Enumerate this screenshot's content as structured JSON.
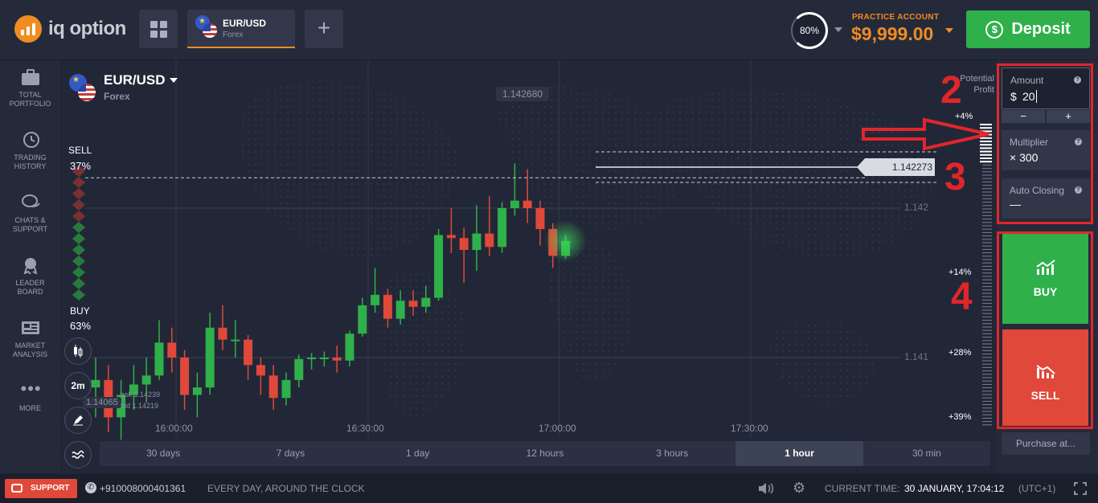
{
  "header": {
    "logo_text": "iq option",
    "asset_tab": {
      "name": "EUR/USD",
      "type": "Forex"
    },
    "profit_percent": "80%",
    "account_label": "PRACTICE ACCOUNT",
    "balance": "$9,999.00",
    "deposit_label": "Deposit"
  },
  "sidebar": {
    "items": [
      {
        "label": "TOTAL PORTFOLIO",
        "icon": "briefcase-icon"
      },
      {
        "label": "TRADING HISTORY",
        "icon": "history-icon"
      },
      {
        "label": "CHATS & SUPPORT",
        "icon": "chat-icon"
      },
      {
        "label": "LEADER BOARD",
        "icon": "medal-icon"
      },
      {
        "label": "MARKET ANALYSIS",
        "icon": "newspaper-icon"
      },
      {
        "label": "MORE",
        "icon": "dots-icon"
      }
    ]
  },
  "chart": {
    "asset": "EUR/USD",
    "asset_type": "Forex",
    "potential_profit_label": "Potential Profit",
    "sell_label": "SELL",
    "sell_pct": "37%",
    "buy_label": "BUY",
    "buy_pct": "63%",
    "price_tag_top": "1.142680",
    "current_price": "1.142273",
    "price_labels": [
      "1.142",
      "1.141"
    ],
    "low_price_tag": "1.14065",
    "ask": "ask 1.14239",
    "bid": "bid 1.14219",
    "time_labels": [
      "16:00:00",
      "16:30:00",
      "17:00:00",
      "17:30:00"
    ],
    "profit_scale": [
      "+4%",
      "+14%",
      "+28%",
      "+39%"
    ],
    "timeframe_button": "2m"
  },
  "timeframes": [
    "30 days",
    "7 days",
    "1 day",
    "12 hours",
    "3 hours",
    "1 hour",
    "30 min"
  ],
  "active_timeframe": "1 hour",
  "trade_panel": {
    "amount_label": "Amount",
    "amount_currency": "$",
    "amount_value": "20",
    "minus": "−",
    "plus": "+",
    "multiplier_label": "Multiplier",
    "multiplier_value": "× 300",
    "auto_closing_label": "Auto Closing",
    "auto_closing_value": "—",
    "buy_label": "BUY",
    "sell_label": "SELL",
    "purchase_at": "Purchase at..."
  },
  "annotations": [
    "2",
    "3",
    "4"
  ],
  "footer": {
    "support_label": "SUPPORT",
    "phone": "+910008000401361",
    "hours": "EVERY DAY, AROUND THE CLOCK",
    "current_time_label": "CURRENT TIME:",
    "current_time_value": "30 JANUARY, 17:04:12",
    "timezone": "(UTC+1)"
  },
  "colors": {
    "accent": "#f08c22",
    "buy": "#2fb04a",
    "sell": "#e0483a",
    "annotation": "#e1262b"
  },
  "candles": [
    {
      "o": 1.1408,
      "c": 1.14085,
      "h": 1.141,
      "l": 1.1406
    },
    {
      "o": 1.14085,
      "c": 1.1406,
      "h": 1.14095,
      "l": 1.1405
    },
    {
      "o": 1.1406,
      "c": 1.14075,
      "h": 1.14085,
      "l": 1.14045
    },
    {
      "o": 1.14075,
      "c": 1.14082,
      "h": 1.14095,
      "l": 1.14065
    },
    {
      "o": 1.14082,
      "c": 1.14088,
      "h": 1.141,
      "l": 1.1407
    },
    {
      "o": 1.14088,
      "c": 1.1411,
      "h": 1.14125,
      "l": 1.14085
    },
    {
      "o": 1.1411,
      "c": 1.141,
      "h": 1.1412,
      "l": 1.1409
    },
    {
      "o": 1.141,
      "c": 1.14075,
      "h": 1.14105,
      "l": 1.14065
    },
    {
      "o": 1.14075,
      "c": 1.1408,
      "h": 1.1409,
      "l": 1.1406
    },
    {
      "o": 1.1408,
      "c": 1.1412,
      "h": 1.1413,
      "l": 1.14075
    },
    {
      "o": 1.1412,
      "c": 1.14112,
      "h": 1.14135,
      "l": 1.14105
    },
    {
      "o": 1.14112,
      "c": 1.14112,
      "h": 1.14125,
      "l": 1.141
    },
    {
      "o": 1.14112,
      "c": 1.14095,
      "h": 1.14115,
      "l": 1.14085
    },
    {
      "o": 1.14095,
      "c": 1.14088,
      "h": 1.141,
      "l": 1.14075
    },
    {
      "o": 1.14088,
      "c": 1.14073,
      "h": 1.14095,
      "l": 1.14065
    },
    {
      "o": 1.14073,
      "c": 1.14085,
      "h": 1.1409,
      "l": 1.14068
    },
    {
      "o": 1.14085,
      "c": 1.14099,
      "h": 1.14102,
      "l": 1.1408
    },
    {
      "o": 1.14099,
      "c": 1.141,
      "h": 1.14103,
      "l": 1.14092
    },
    {
      "o": 1.141,
      "c": 1.141,
      "h": 1.14104,
      "l": 1.14094
    },
    {
      "o": 1.141,
      "c": 1.14098,
      "h": 1.14108,
      "l": 1.1409
    },
    {
      "o": 1.14098,
      "c": 1.14116,
      "h": 1.14118,
      "l": 1.14094
    },
    {
      "o": 1.14116,
      "c": 1.14135,
      "h": 1.1414,
      "l": 1.14114
    },
    {
      "o": 1.14135,
      "c": 1.14142,
      "h": 1.1416,
      "l": 1.1413
    },
    {
      "o": 1.14142,
      "c": 1.14126,
      "h": 1.14146,
      "l": 1.1412
    },
    {
      "o": 1.14126,
      "c": 1.14138,
      "h": 1.14145,
      "l": 1.14122
    },
    {
      "o": 1.14138,
      "c": 1.14134,
      "h": 1.14145,
      "l": 1.14128
    },
    {
      "o": 1.14134,
      "c": 1.1414,
      "h": 1.14148,
      "l": 1.1413
    },
    {
      "o": 1.1414,
      "c": 1.14182,
      "h": 1.14186,
      "l": 1.14138
    },
    {
      "o": 1.14182,
      "c": 1.1418,
      "h": 1.142,
      "l": 1.1417
    },
    {
      "o": 1.1418,
      "c": 1.14172,
      "h": 1.14187,
      "l": 1.1415
    },
    {
      "o": 1.14172,
      "c": 1.14183,
      "h": 1.14202,
      "l": 1.14158
    },
    {
      "o": 1.14183,
      "c": 1.14174,
      "h": 1.14208,
      "l": 1.14168
    },
    {
      "o": 1.14174,
      "c": 1.142,
      "h": 1.14204,
      "l": 1.1417
    },
    {
      "o": 1.142,
      "c": 1.14205,
      "h": 1.1423,
      "l": 1.14195
    },
    {
      "o": 1.14205,
      "c": 1.142,
      "h": 1.14226,
      "l": 1.1419
    },
    {
      "o": 1.142,
      "c": 1.14186,
      "h": 1.14205,
      "l": 1.14175
    },
    {
      "o": 1.14186,
      "c": 1.14168,
      "h": 1.1419,
      "l": 1.1416
    },
    {
      "o": 1.14168,
      "c": 1.14178,
      "h": 1.14182,
      "l": 1.14166
    }
  ]
}
